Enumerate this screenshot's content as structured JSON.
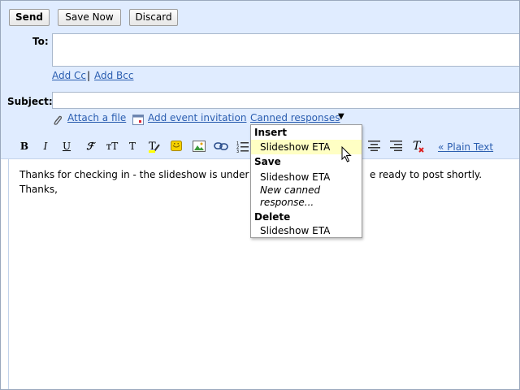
{
  "buttons": {
    "send": "Send",
    "save_now": "Save Now",
    "discard": "Discard"
  },
  "fields": {
    "to_label": "To:",
    "subject_label": "Subject:",
    "add_cc": "Add Cc",
    "separator": "|",
    "add_bcc": "Add Bcc"
  },
  "links": {
    "attach": "Attach a file",
    "event": "Add event invitation",
    "canned": "Canned responses",
    "canned_arrow": "▼",
    "plain_text": "« Plain Text"
  },
  "toolbar": {
    "bold": "B",
    "italic": "I",
    "underline": "U",
    "font": "ℱ",
    "size": "тT",
    "text_color": "T"
  },
  "dropdown": {
    "insert_header": "Insert",
    "insert_item": "Slideshow ETA",
    "save_header": "Save",
    "save_item": "Slideshow ETA",
    "new_response_line1": "New canned",
    "new_response_line2": "response...",
    "delete_header": "Delete",
    "delete_item": "Slideshow ETA"
  },
  "message": {
    "line1_left": "Thanks for checking in - the slideshow is under",
    "line1_right": "e ready to post shortly.",
    "line2": "Thanks,"
  },
  "colors": {
    "accent": "#e0ecff",
    "link": "#2a5db0",
    "highlight": "#ffffc4"
  }
}
